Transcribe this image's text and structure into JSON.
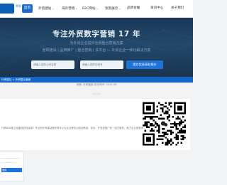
{
  "nav": {
    "logo_text": "外贸",
    "items": [
      {
        "label": "首页",
        "active": true,
        "has_menu": false
      },
      {
        "label": "外贸建站",
        "active": false,
        "has_menu": true
      },
      {
        "label": "海外营销",
        "active": false,
        "has_menu": true
      },
      {
        "label": "B2C网站",
        "active": false,
        "has_menu": true
      },
      {
        "label": "案例展示",
        "active": false,
        "has_menu": true
      },
      {
        "label": "品牌台推",
        "active": false,
        "has_menu": false
      },
      {
        "label": "资讯中心",
        "active": false,
        "has_menu": false
      },
      {
        "label": "关于我们",
        "active": false,
        "has_menu": false
      }
    ]
  },
  "hero": {
    "title": "专注外贸数字营销 17 年",
    "subtitle1": "为外贸企业提供全网整合营销方案",
    "subtitle2": "官网建设 | 品牌推广 | 整合营销 | 多平台 — 外贸企业一体化解决方案",
    "name_placeholder": "请输入您的公司名称",
    "phone_placeholder": "请输入您的手机号",
    "cta_label": "提交信息获取报价"
  },
  "breadcrumb": "外贸建站 > 外贸整合营销",
  "source_line": "来源: 外贸营销   发布时间: 2024-06",
  "number_tag": "11 / 1",
  "article_text": "外贸B2B独立站建设如何选择？专业的外贸建站服务商可以为企业提供从网站策划、设计、开发到推广的一站式服务，助力企业拓展海外市场。",
  "bottom": {
    "btn_label": "搜索"
  },
  "colors": {
    "primary": "#1e73d6",
    "bar": "#1565c9",
    "hero_bg": "#1f4163"
  }
}
